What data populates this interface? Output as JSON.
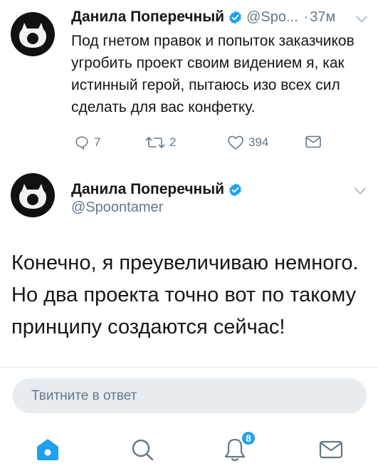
{
  "accent_color": "#1da1f2",
  "tweets": [
    {
      "author_name": "Данила Поперечный",
      "handle": "@Spo...",
      "time_sep": "·",
      "time": "37м",
      "verified": true,
      "text": "Под гнетом правок и попыток заказчиков угробить проект своим видением я, как истинный герой, пытаюсь изо всех сил сделать для вас конфетку.",
      "reply_count": "7",
      "retweet_count": "2",
      "like_count": "394"
    },
    {
      "author_name": "Данила Поперечный",
      "handle": "@Spoontamer",
      "verified": true,
      "text": "Конечно, я преувеличиваю немного. Но два проекта точно вот по такому принципу создаются сейчас!"
    }
  ],
  "reply_bar": {
    "placeholder": "Твитните в ответ"
  },
  "tabbar": {
    "notifications_badge": "8",
    "icons": [
      "home-icon",
      "search-icon",
      "bell-icon",
      "mail-icon"
    ]
  }
}
